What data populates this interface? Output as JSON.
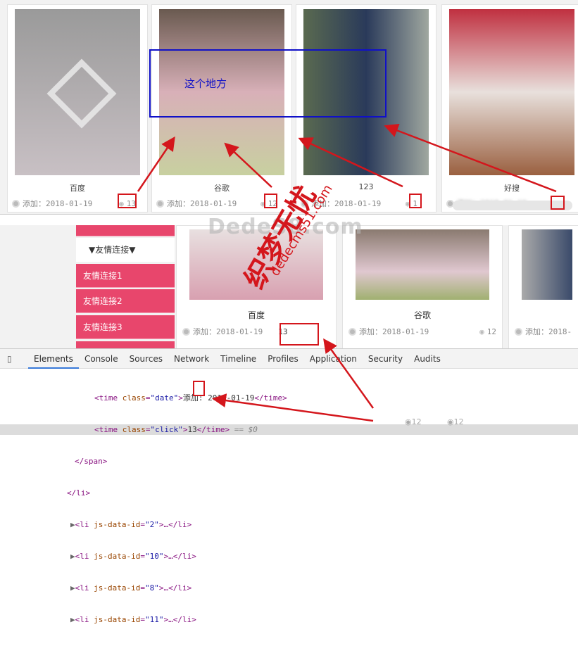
{
  "top_cards": [
    {
      "title": "百度",
      "date": "添加：2018-01-19",
      "clicks": "13"
    },
    {
      "title": "谷歌",
      "date": "添加：2018-01-19",
      "clicks": "12"
    },
    {
      "title": "123",
      "date": "添加：2018-01-19",
      "clicks": "1"
    },
    {
      "title": "好搜",
      "date": "添加：2018-01-19",
      "clicks": ""
    }
  ],
  "annotation": "这个地方",
  "watermark": {
    "brand": "DedeS8.com",
    "signature": "织梦无忧",
    "site": "dedecms51.com"
  },
  "sidebar": {
    "header": "▼友情连接▼",
    "items": [
      "友情连接1",
      "友情连接2",
      "友情连接3"
    ]
  },
  "bottom_cards": [
    {
      "title": "百度",
      "date": "添加：2018-01-19",
      "clicks": "13"
    },
    {
      "title": "谷歌",
      "date": "添加：2018-01-19",
      "clicks": "12"
    },
    {
      "title": "",
      "date": "添加：2018-",
      "clicks": ""
    }
  ],
  "devtools": {
    "tabs": [
      "Elements",
      "Console",
      "Sources",
      "Network",
      "Timeline",
      "Profiles",
      "Application",
      "Security",
      "Audits"
    ],
    "date_text": "添加: 2018-01-19",
    "click_text": "13",
    "selected_marker": "== $0",
    "li_ids": [
      "2",
      "10",
      "8",
      "11"
    ]
  },
  "stray_counts": [
    "12",
    "12"
  ],
  "colors": {
    "accent": "#e8466c",
    "annotation_red": "#d4161c",
    "annotation_blue": "#1010c8",
    "devtools_tab": "#3879d9"
  }
}
